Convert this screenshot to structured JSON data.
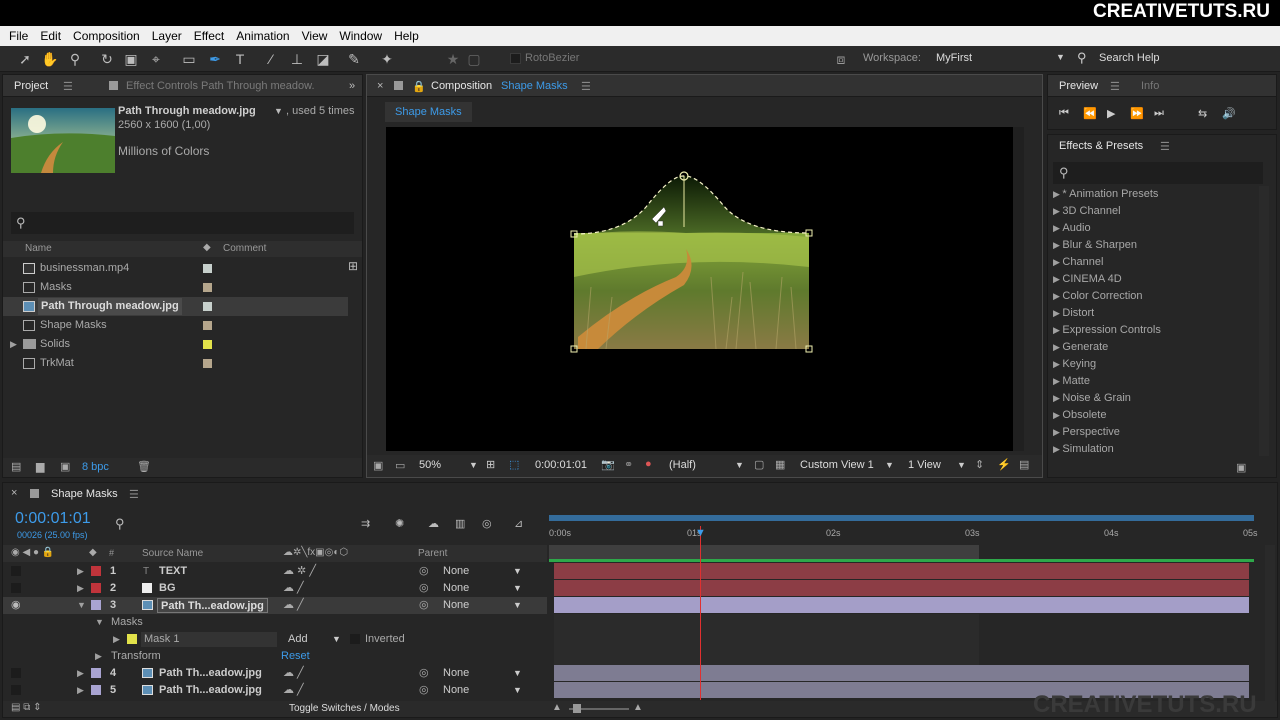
{
  "brand": "CREATIVETUTS.RU",
  "watermark": "CREATIVETUTS.RU",
  "menu": [
    "File",
    "Edit",
    "Composition",
    "Layer",
    "Effect",
    "Animation",
    "View",
    "Window",
    "Help"
  ],
  "toolbar": {
    "rotobezier": "RotoBezier",
    "workspace_label": "Workspace:",
    "workspace_value": "MyFirst",
    "search_help": "Search Help"
  },
  "project": {
    "tab": "Project",
    "effect_tab": "Effect Controls Path Through meadow.",
    "item_name": "Path Through meadow.jpg",
    "item_used": ", used 5 times",
    "item_dims": "2560 x 1600 (1,00)",
    "item_colors": "Millions of Colors",
    "col_name": "Name",
    "col_comment": "Comment",
    "items": [
      {
        "name": "businessman.mp4",
        "color": "#c7d0cc"
      },
      {
        "name": "Masks",
        "color": "#b5a68c"
      },
      {
        "name": "Path Through meadow.jpg",
        "color": "#c7d0cc"
      },
      {
        "name": "Shape Masks",
        "color": "#b5a68c"
      },
      {
        "name": "Solids",
        "color": "#e2e24a"
      },
      {
        "name": "TrkMat",
        "color": "#b5a68c"
      }
    ],
    "bpc": "8 bpc"
  },
  "comp": {
    "label": "Composition",
    "name": "Shape Masks",
    "tab": "Shape Masks",
    "zoom": "50%",
    "time": "0:00:01:01",
    "resolution": "(Half)",
    "view": "Custom View 1",
    "views": "1 View"
  },
  "preview": {
    "tab": "Preview",
    "info": "Info"
  },
  "effects": {
    "title": "Effects & Presets",
    "items": [
      "* Animation Presets",
      "3D Channel",
      "Audio",
      "Blur & Sharpen",
      "Channel",
      "CINEMA 4D",
      "Color Correction",
      "Distort",
      "Expression Controls",
      "Generate",
      "Keying",
      "Matte",
      "Noise & Grain",
      "Obsolete",
      "Perspective",
      "Simulation"
    ]
  },
  "timeline": {
    "tab": "Shape Masks",
    "time": "0:00:01:01",
    "frames": "00026 (25.00 fps)",
    "col_source": "Source Name",
    "col_parent": "Parent",
    "ruler": [
      "0:00s",
      "01s",
      "02s",
      "03s",
      "04s",
      "05s"
    ],
    "layers": [
      {
        "num": "1",
        "name": "TEXT",
        "color": "#c0343b",
        "parent": "None"
      },
      {
        "num": "2",
        "name": "BG",
        "color": "#c0343b",
        "parent": "None"
      },
      {
        "num": "3",
        "name": "Path Th...eadow.jpg",
        "color": "#a9a4d2",
        "parent": "None"
      },
      {
        "num": "4",
        "name": "Path Th...eadow.jpg",
        "color": "#a9a4d2",
        "parent": "None"
      },
      {
        "num": "5",
        "name": "Path Th...eadow.jpg",
        "color": "#a9a4d2",
        "parent": "None"
      }
    ],
    "masks_label": "Masks",
    "mask1": "Mask 1",
    "mask_mode": "Add",
    "inverted": "Inverted",
    "transform": "Transform",
    "reset": "Reset",
    "toggle": "Toggle Switches / Modes"
  }
}
